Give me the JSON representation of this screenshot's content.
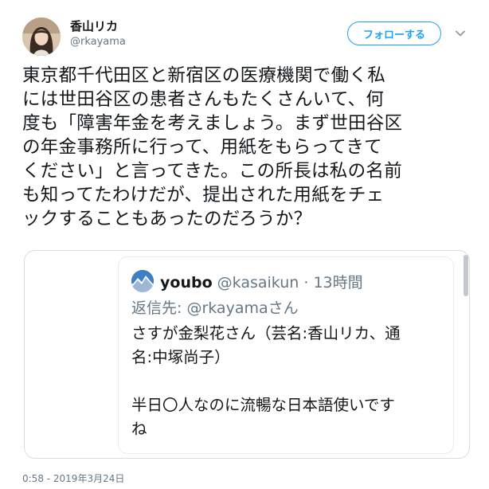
{
  "author": {
    "display_name": "香山リカ",
    "handle": "@rkayama",
    "follow_label": "フォローする"
  },
  "tweet": {
    "text": "東京都千代田区と新宿区の医療機関で働く私\nには世田谷区の患者さんもたくさんいて、何\n度も「障害年金を考えましょう。まず世田谷区\nの年金事務所に行って、用紙をもらってきて\nください」と言ってきた。この所長は私の名前\nも知ってたわけだが、提出された用紙をチェ\nックすることもあったのだろうか？",
    "timestamp": "0:58 - 2019年3月24日"
  },
  "quoted": {
    "display_name": "youbo",
    "handle": "@kasaikun",
    "separator": "·",
    "time": "13時間",
    "reply_prefix": "返信先:",
    "reply_handle": "@rkayama",
    "reply_suffix": "さん",
    "text": "さすが金梨花さん（芸名:香山リカ、通\n名:中塚尚子）\n\n半日〇人なのに流暢な日本語使いです\nね"
  },
  "icons": {
    "avatar": "profile-photo",
    "caret": "chevron-down-icon",
    "quoted_avatar": "profile-photo-mountain"
  },
  "colors": {
    "accent": "#1da1f2",
    "text": "#14171a",
    "secondary": "#657786",
    "border": "#d6dde3"
  }
}
